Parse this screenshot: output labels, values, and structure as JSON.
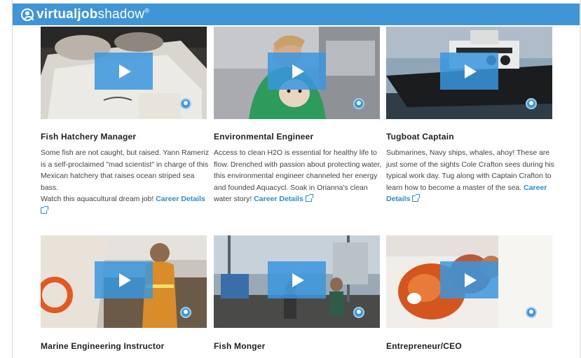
{
  "header": {
    "logo_part1": "virtual",
    "logo_part2": "job",
    "logo_part3": "shadow",
    "logo_reg": "®"
  },
  "cards": [
    {
      "title": "Fish Hatchery Manager",
      "desc_lines": [
        "Some fish are not caught, but raised. Yann Rameriz",
        "is a self-proclaimed \"mad scientist\" in charge of this",
        "Mexican hatchery that raises ocean striped sea bass.",
        "Watch this aquacultural dream job!"
      ],
      "link": "Career Details"
    },
    {
      "title": "Environmental Engineer",
      "desc_lines": [
        "Access to clean H2O is essential for healthy life to",
        "flow. Drenched with passion about protecting water,",
        "this environmental engineer channeled her energy",
        "and founded Aquacycl. Soak in Orianna's clean",
        "water story!"
      ],
      "link": "Career Details"
    },
    {
      "title": "Tugboat Captain",
      "desc_lines": [
        "Submarines, Navy ships, whales, ahoy! These are",
        "just some of the sights Cole Crafton sees during his",
        "typical work day. Tug along with Captain Crafton to",
        "learn how to become a master of the sea."
      ],
      "link": "Career",
      "link2": "Details"
    },
    {
      "title": "Marine Engineering Instructor"
    },
    {
      "title": "Fish Monger"
    },
    {
      "title": "Entrepreneur/CEO"
    }
  ],
  "icons": {
    "play": "play-icon",
    "badge": "vjs-badge-icon",
    "external": "external-link-icon"
  },
  "colors": {
    "header": "#3f95d6",
    "play_overlay": "#3a96de",
    "link": "#2f8ed3"
  }
}
